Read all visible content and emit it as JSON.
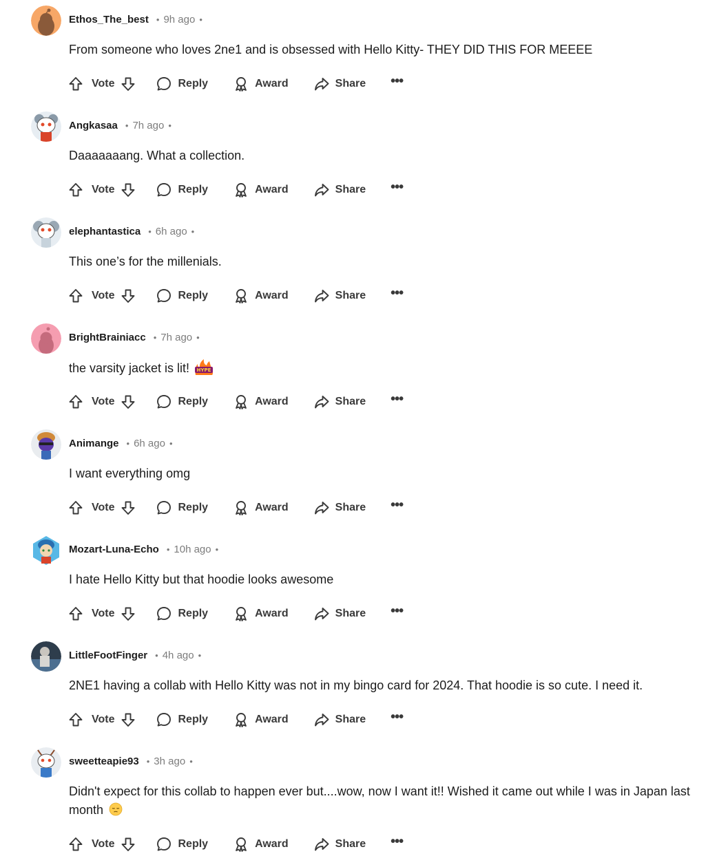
{
  "actions": {
    "vote": "Vote",
    "reply": "Reply",
    "award": "Award",
    "share": "Share",
    "more": "•••"
  },
  "comments": [
    {
      "username": "Ethos_The_best",
      "time": "9h ago",
      "body": "From someone who loves 2ne1 and is obsessed with Hello Kitty- THEY DID THIS FOR MEEEE",
      "avatar_color": "#f7a767"
    },
    {
      "username": "Angkasaa",
      "time": "7h ago",
      "body": "Daaaaaaang. What a collection.",
      "avatar_color": "#9ec0d8"
    },
    {
      "username": "elephantastica",
      "time": "6h ago",
      "body": "This one’s for the millenials.",
      "avatar_color": "#a8b4bf"
    },
    {
      "username": "BrightBrainiacc",
      "time": "7h ago",
      "body": "the varsity jacket is lit!",
      "emoji": "HYPE",
      "avatar_color": "#f59db0"
    },
    {
      "username": "Animange",
      "time": "6h ago",
      "body": "I want everything omg",
      "avatar_color": "#dfe3e8"
    },
    {
      "username": "Mozart-Luna-Echo",
      "time": "10h ago",
      "body": "I hate Hello Kitty but that hoodie looks awesome",
      "avatar_color": "#58b8e6"
    },
    {
      "username": "LittleFootFinger",
      "time": "4h ago",
      "body": "2NE1 having a collab with Hello Kitty was not in my bingo card for 2024. That hoodie is so cute. I need it.",
      "avatar_color": "#4a5a6a"
    },
    {
      "username": "sweetteapie93",
      "time": "3h ago",
      "body": "Didn't expect for this collab to happen ever but....wow, now I want it!! Wished it came out while I was in Japan last month",
      "emoji": "pensive-face",
      "avatar_color": "#e9edf1"
    }
  ]
}
